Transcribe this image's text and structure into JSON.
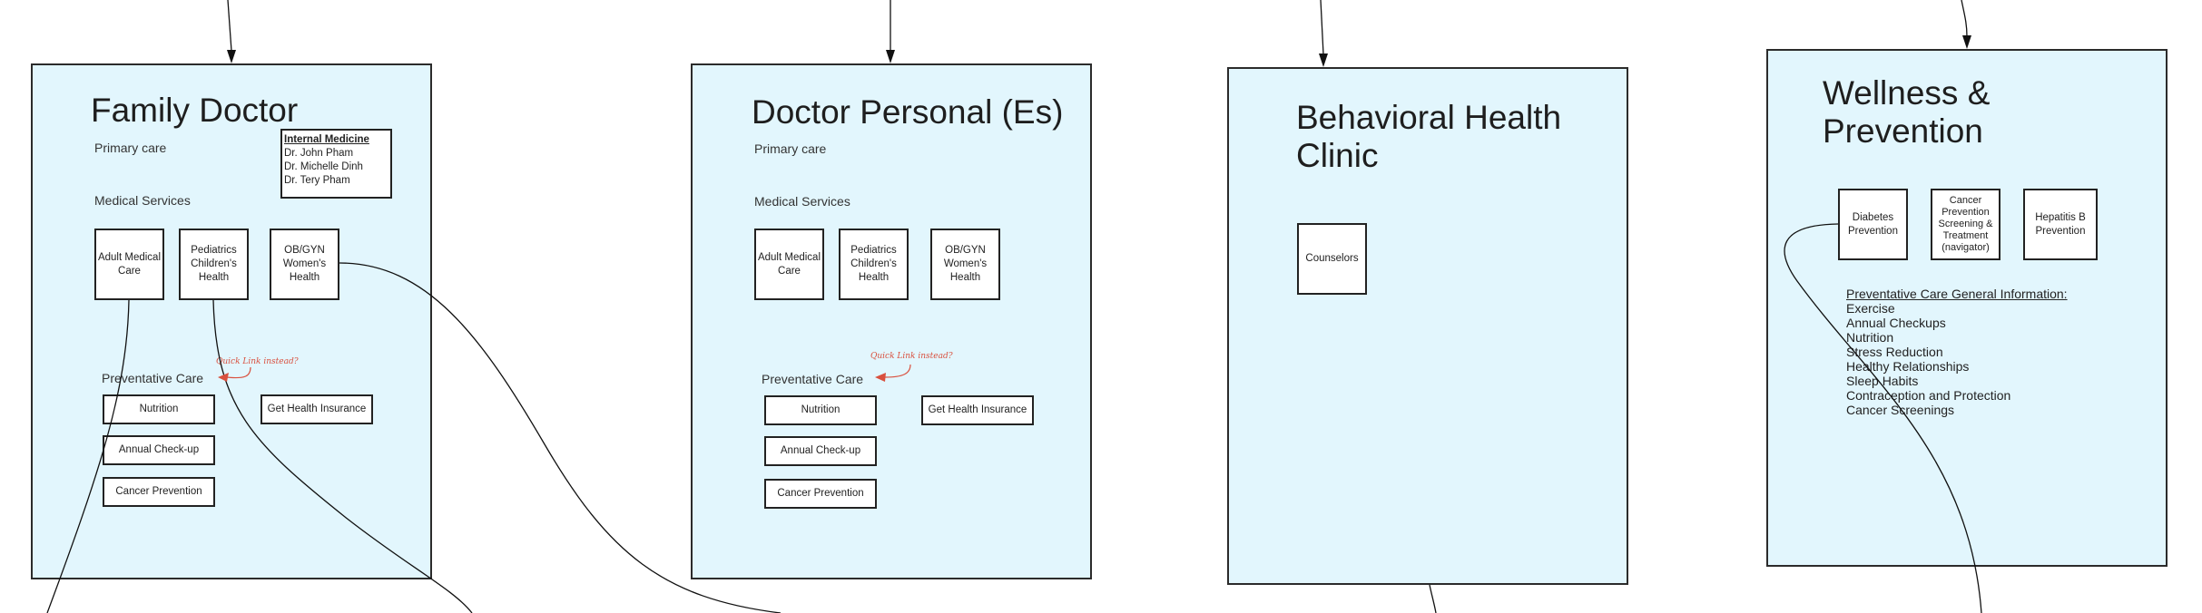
{
  "colors": {
    "panel_fill": "#e2f6fd",
    "annotation": "#d9503e"
  },
  "family_doctor": {
    "title": "Family Doctor",
    "primary_care": "Primary care",
    "internal_medicine": {
      "heading": "Internal Medicine",
      "doctors": [
        "Dr. John Pham",
        "Dr. Michelle Dinh",
        "Dr. Tery Pham"
      ]
    },
    "medical_services": "Medical Services",
    "services": [
      "Adult Medical Care",
      "Pediatrics Children's Health",
      "OB/GYN Women's Health"
    ],
    "note": "Quick Link instead?",
    "preventative_care": "Preventative Care",
    "preventative_items": [
      "Nutrition",
      "Annual Check-up",
      "Cancer Prevention"
    ],
    "insurance": "Get Health Insurance"
  },
  "doctor_personal": {
    "title": "Doctor Personal (Es)",
    "primary_care": "Primary care",
    "medical_services": "Medical Services",
    "services": [
      "Adult Medical Care",
      "Pediatrics Children's Health",
      "OB/GYN Women's Health"
    ],
    "note": "Quick Link instead?",
    "preventative_care": "Preventative Care",
    "preventative_items": [
      "Nutrition",
      "Annual Check-up",
      "Cancer Prevention"
    ],
    "insurance": "Get Health Insurance"
  },
  "behavioral": {
    "title_line1": "Behavioral Health",
    "title_line2": "Clinic",
    "services": [
      "Counselors"
    ]
  },
  "wellness": {
    "title_line1": "Wellness &",
    "title_line2": "Prevention",
    "services": [
      "Diabetes Prevention",
      "Cancer Prevention Screening & Treatment (navigator)",
      "Hepatitis B Prevention"
    ],
    "info_heading": "Preventative Care General Information:",
    "info_items": [
      "Exercise",
      "Annual Checkups",
      "Nutrition",
      "Stress Reduction",
      "Healthy Relationships",
      "Sleep Habits",
      "Contraception and Protection",
      "Cancer Screenings"
    ]
  }
}
